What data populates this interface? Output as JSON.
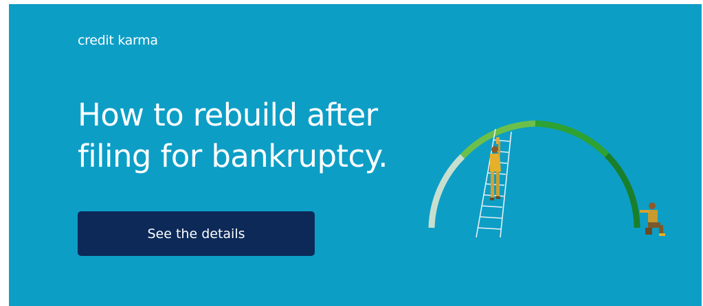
{
  "brand": {
    "name": "credit karma",
    "mark": "·"
  },
  "hero": {
    "headline": "How to rebuild after filing for bankruptcy."
  },
  "cta": {
    "label": "See the details"
  },
  "illustration": {
    "icon": "credit-score-arc-with-ladder-illustration",
    "arc_colors": [
      "#c8dfcf",
      "#6cc04a",
      "#2ea232",
      "#1a7f2b"
    ],
    "figures": [
      "person-climbing-ladder",
      "person-kneeling-at-arc-end"
    ]
  },
  "colors": {
    "background": "#0d9ec6",
    "button": "#0c2958",
    "text": "#ffffff"
  }
}
